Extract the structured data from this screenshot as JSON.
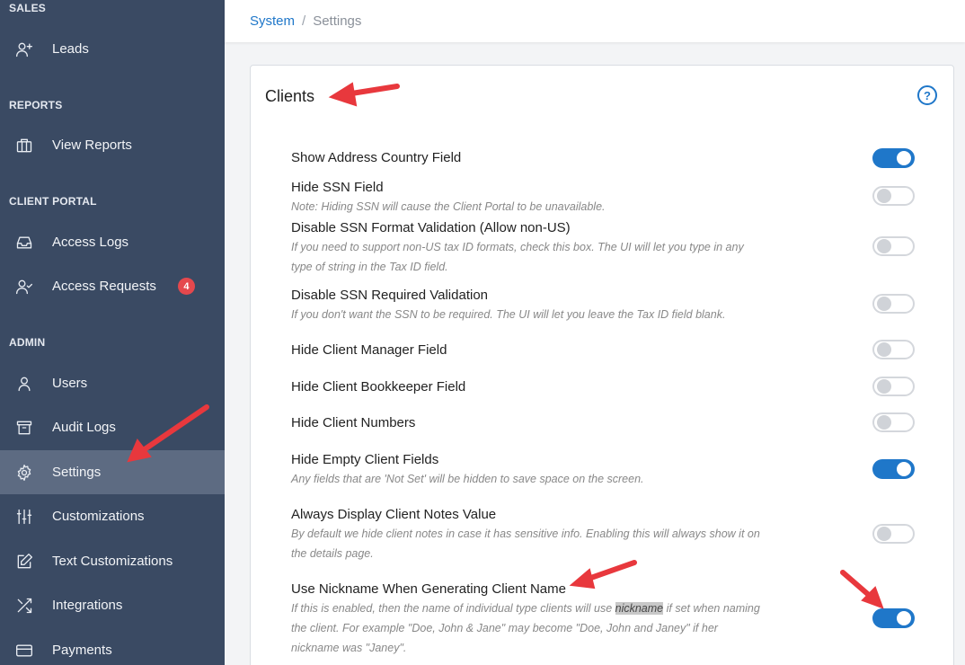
{
  "sidebar": {
    "sections": [
      {
        "title": "SALES",
        "items": [
          {
            "label": "Leads",
            "icon": "user-plus-icon"
          }
        ]
      },
      {
        "title": "REPORTS",
        "items": [
          {
            "label": "View Reports",
            "icon": "briefcase-icon"
          }
        ]
      },
      {
        "title": "CLIENT PORTAL",
        "items": [
          {
            "label": "Access Logs",
            "icon": "inbox-icon"
          },
          {
            "label": "Access Requests",
            "icon": "user-check-icon",
            "badge": "4"
          }
        ]
      },
      {
        "title": "ADMIN",
        "items": [
          {
            "label": "Users",
            "icon": "user-icon"
          },
          {
            "label": "Audit Logs",
            "icon": "archive-icon"
          },
          {
            "label": "Settings",
            "icon": "gear-icon",
            "active": true
          },
          {
            "label": "Customizations",
            "icon": "sliders-icon"
          },
          {
            "label": "Text Customizations",
            "icon": "edit-icon"
          },
          {
            "label": "Integrations",
            "icon": "shuffle-icon"
          },
          {
            "label": "Payments",
            "icon": "credit-card-icon"
          }
        ]
      }
    ]
  },
  "breadcrumb": {
    "root": "System",
    "separator": "/",
    "current": "Settings"
  },
  "card": {
    "title": "Clients",
    "help": "?",
    "settings": [
      {
        "label": "Show Address Country Field",
        "on": true
      },
      {
        "label": "Hide SSN Field",
        "note": "Note: Hiding SSN will cause the Client Portal to be unavailable.",
        "on": false
      },
      {
        "label": "Disable SSN Format Validation (Allow non-US)",
        "note": "If you need to support non-US tax ID formats, check this box. The UI will let you type in any type of string in the Tax ID field.",
        "on": false
      },
      {
        "label": "Disable SSN Required Validation",
        "note": "If you don't want the SSN to be required. The UI will let you leave the Tax ID field blank.",
        "on": false
      },
      {
        "label": "Hide Client Manager Field",
        "on": false
      },
      {
        "label": "Hide Client Bookkeeper Field",
        "on": false
      },
      {
        "label": "Hide Client Numbers",
        "on": false
      },
      {
        "label": "Hide Empty Client Fields",
        "note": "Any fields that are 'Not Set' will be hidden to save space on the screen.",
        "on": true
      },
      {
        "label": "Always Display Client Notes Value",
        "note": "By default we hide client notes in case it has sensitive info. Enabling this will always show it on the details page.",
        "on": false
      },
      {
        "label": "Use Nickname When Generating Client Name",
        "note_pre": "If this is enabled, then the name of individual type clients will use ",
        "note_hl": "nickname",
        "note_post": " if set when naming the client. For example \"Doe, John & Jane\" may become \"Doe, John and Janey\" if her nickname was \"Janey\".",
        "on": true
      }
    ]
  },
  "colors": {
    "sidebar": "#3a4a63",
    "active": "#5d6b82",
    "accent": "#1f77c9",
    "badge": "#e5484d",
    "arrow": "#e8383d"
  }
}
